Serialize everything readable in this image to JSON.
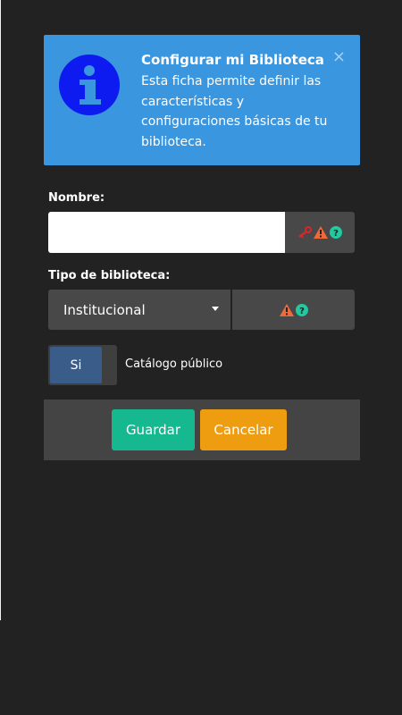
{
  "info": {
    "title": "Configurar mi Biblioteca",
    "text": "Esta ficha permite definir las características y configuraciones básicas de tu biblioteca.",
    "icon": "info-icon",
    "close_glyph": "×"
  },
  "form": {
    "name_label": "Nombre:",
    "name_value": "",
    "name_placeholder": "",
    "type_label": "Tipo de biblioteca:",
    "type_value": "Institucional",
    "public_toggle_value": "Si",
    "public_label": "Catálogo público"
  },
  "buttons": {
    "save": "Guardar",
    "cancel": "Cancelar"
  },
  "colors": {
    "background": "#222222",
    "info_box": "#3a96df",
    "save": "#15b88f",
    "cancel": "#ef9d10",
    "toggle_on": "#395c88",
    "warning": "#ef6a3a",
    "help": "#22c9a0",
    "key": "#d4282a"
  },
  "icons": [
    "info-icon",
    "close-icon",
    "key-icon",
    "warning-icon",
    "help-icon",
    "chevron-down-icon"
  ]
}
